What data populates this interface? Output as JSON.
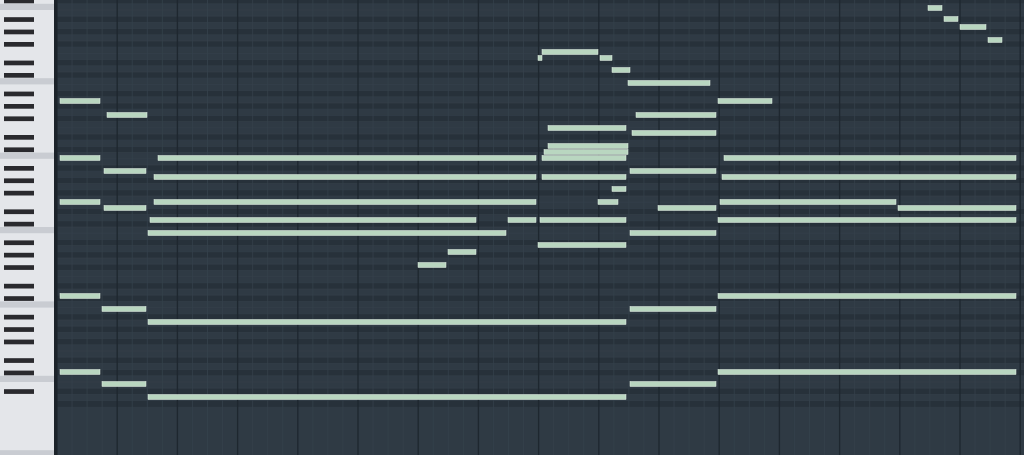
{
  "editor": {
    "kind": "piano-roll"
  }
}
